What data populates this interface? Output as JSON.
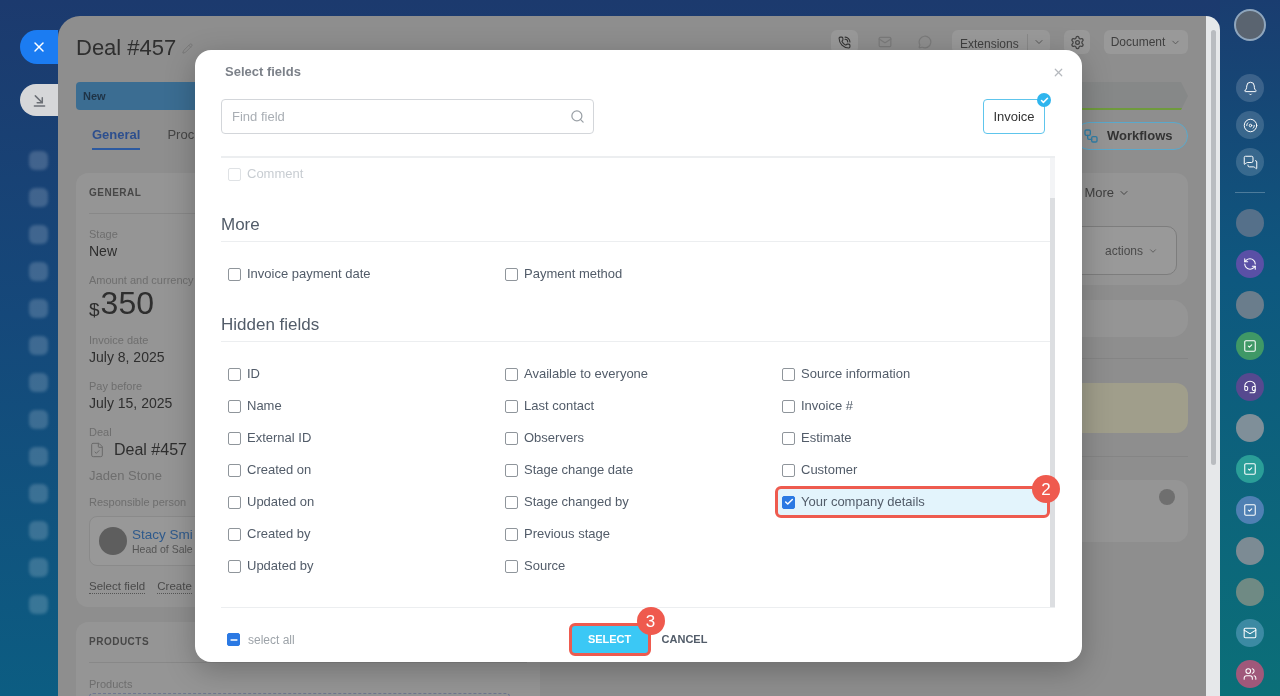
{
  "deal": {
    "title": "Deal #457",
    "extensions_button": "Extensions",
    "document_button": "Document",
    "stage": "New",
    "tabs": [
      {
        "label": "General",
        "selected": true
      },
      {
        "label": "Proc",
        "selected": false
      }
    ],
    "workflows_button": "Workflows",
    "general_card": {
      "heading": "GENERAL",
      "fields": [
        {
          "kind": "text",
          "label": "Stage",
          "value": "New"
        },
        {
          "kind": "amount",
          "label": "Amount and currency",
          "currency": "$",
          "value": "350"
        },
        {
          "kind": "text",
          "label": "Invoice date",
          "value": "July 8, 2025"
        },
        {
          "kind": "text",
          "label": "Pay before",
          "value": "July 15, 2025"
        },
        {
          "kind": "document",
          "label": "Deal",
          "value": "Deal #457",
          "note": "Jaden Stone"
        },
        {
          "kind": "person",
          "label": "Responsible person",
          "name": "Stacy Smi",
          "position": "Head of Sale"
        }
      ],
      "links": [
        "Select field",
        "Create"
      ]
    },
    "products_card": {
      "heading": "PRODUCTS",
      "label": "Products"
    },
    "more_menu": "More",
    "actions_button": "actions"
  },
  "modal": {
    "title": "Select fields",
    "search": {
      "placeholder": "Find field"
    },
    "entity_chip": {
      "label": "Invoice",
      "selected": true
    },
    "sections": [
      {
        "faded": true,
        "items": [
          {
            "label": "Comment",
            "checked": false
          }
        ]
      },
      {
        "heading": "More",
        "items": [
          {
            "label": "Invoice payment date",
            "checked": false
          },
          {
            "label": "Payment method",
            "checked": false
          }
        ]
      },
      {
        "heading": "Hidden fields",
        "items": [
          {
            "label": "ID",
            "checked": false
          },
          {
            "label": "Name",
            "checked": false
          },
          {
            "label": "External ID",
            "checked": false
          },
          {
            "label": "Created on",
            "checked": false
          },
          {
            "label": "Updated on",
            "checked": false
          },
          {
            "label": "Created by",
            "checked": false
          },
          {
            "label": "Updated by",
            "checked": false
          },
          {
            "label": "Available to everyone",
            "checked": false
          },
          {
            "label": "Last contact",
            "checked": false
          },
          {
            "label": "Observers",
            "checked": false
          },
          {
            "label": "Stage change date",
            "checked": false
          },
          {
            "label": "Stage changed by",
            "checked": false
          },
          {
            "label": "Previous stage",
            "checked": false
          },
          {
            "label": "Source",
            "checked": false
          },
          {
            "label": "Source information",
            "checked": false
          },
          {
            "label": "Invoice #",
            "checked": false
          },
          {
            "label": "Estimate",
            "checked": false
          },
          {
            "label": "Customer",
            "checked": false
          },
          {
            "label": "Your company details",
            "checked": true,
            "callout": "2"
          }
        ]
      }
    ],
    "select_all": {
      "label": "select all",
      "indeterminate": true
    },
    "buttons": [
      {
        "kind": "primary",
        "label": "SELECT",
        "callout": "3"
      },
      {
        "kind": "link",
        "label": "CANCEL"
      }
    ]
  }
}
